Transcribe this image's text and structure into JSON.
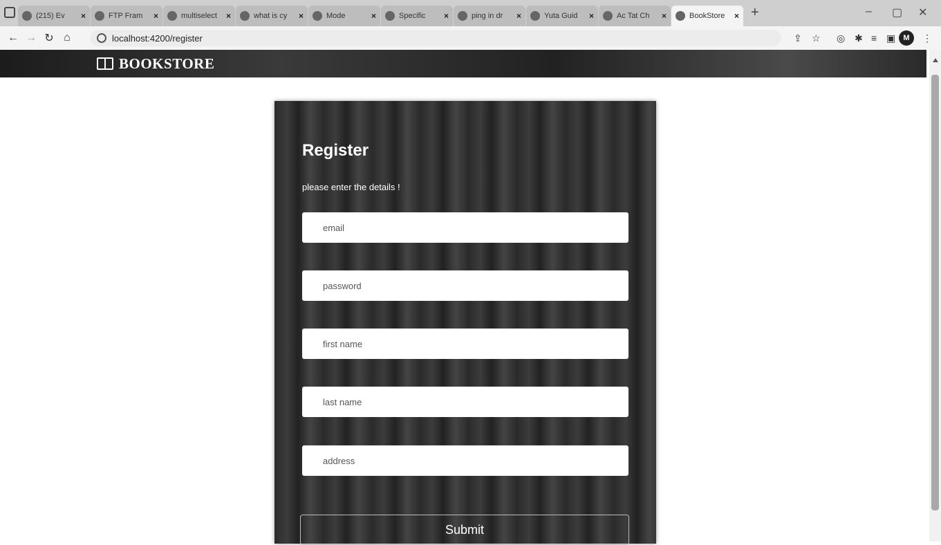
{
  "browser": {
    "tabs": [
      {
        "title": "(215) Ev",
        "active": false
      },
      {
        "title": "FTP Fram",
        "active": false
      },
      {
        "title": "multiselect",
        "active": false
      },
      {
        "title": "what is cy",
        "active": false
      },
      {
        "title": "Mode",
        "active": false
      },
      {
        "title": "Specific",
        "active": false
      },
      {
        "title": "ping in dr",
        "active": false
      },
      {
        "title": "Yuta Guid",
        "active": false
      },
      {
        "title": "Ac Tat Ch",
        "active": false
      },
      {
        "title": "BookStore",
        "active": true
      }
    ],
    "url": "localhost:4200/register",
    "profile_initial": "M"
  },
  "app": {
    "brand": "BOOKSTORE"
  },
  "form": {
    "title": "Register",
    "subtitle": "please enter the details !",
    "fields": [
      {
        "placeholder": "email"
      },
      {
        "placeholder": "password"
      },
      {
        "placeholder": "first name"
      },
      {
        "placeholder": "last name"
      },
      {
        "placeholder": "address"
      }
    ],
    "submit_label": "Submit"
  }
}
